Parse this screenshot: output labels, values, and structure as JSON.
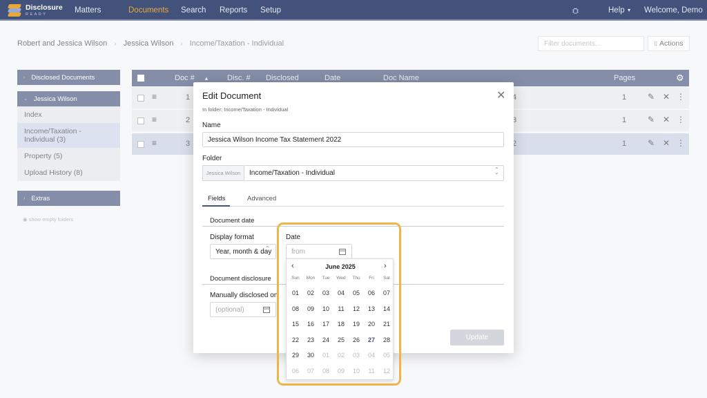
{
  "brand": {
    "name": "Disclosure",
    "tagline": "READY"
  },
  "nav": {
    "items": [
      "Matters",
      "Documents",
      "Search",
      "Reports",
      "Setup"
    ],
    "help": "Help",
    "welcome": "Welcome, Demo"
  },
  "breadcrumb": [
    "Robert and Jessica Wilson",
    "Jessica Wilson",
    "Income/Taxation - Individual"
  ],
  "filter_placeholder": "Filter documents...",
  "actions_label": "Actions",
  "sidebar": {
    "disclosed": "Disclosed Documents",
    "client": "Jessica Wilson",
    "items": [
      "Index",
      "Income/Taxation - Individual (3)",
      "Property (5)",
      "Upload History (8)"
    ],
    "extras": "Extras",
    "show_empty": "show empty folders"
  },
  "table": {
    "headers": {
      "doc": "Doc #",
      "disc": "Disc. #",
      "disclosed": "Disclosed",
      "date": "Date",
      "name": "Doc Name",
      "pages": "Pages"
    },
    "rows": [
      {
        "doc": "1",
        "name_tail": "4",
        "pages": "1"
      },
      {
        "doc": "2",
        "name_tail": "3",
        "pages": "1"
      },
      {
        "doc": "3",
        "name_tail": "2",
        "pages": "1"
      }
    ]
  },
  "modal": {
    "title": "Edit Document",
    "subtitle": "In folder: Income/Taxation - Individual",
    "name_label": "Name",
    "name_value": "Jessica Wilson Income Tax Statement 2022",
    "folder_label": "Folder",
    "folder_prefix": "Jessica Wilson",
    "folder_value": "Income/Taxation - Individual",
    "tabs": [
      "Fields",
      "Advanced"
    ],
    "section_date": "Document date",
    "display_format_label": "Display format",
    "display_format_value": "Year, month & day",
    "date_label": "Date",
    "date_placeholder": "from",
    "section_disclosure": "Document disclosure",
    "manually_disclosed_label": "Manually disclosed on",
    "manually_disclosed_placeholder": "(optional)",
    "update_label": "Update"
  },
  "calendar": {
    "title": "June 2025",
    "weekdays": [
      "Sun",
      "Mon",
      "Tue",
      "Wed",
      "Thu",
      "Fri",
      "Sat"
    ],
    "today": "27",
    "weeks": [
      [
        "01",
        "02",
        "03",
        "04",
        "05",
        "06",
        "07"
      ],
      [
        "08",
        "09",
        "10",
        "11",
        "12",
        "13",
        "14"
      ],
      [
        "15",
        "16",
        "17",
        "18",
        "19",
        "20",
        "21"
      ],
      [
        "22",
        "23",
        "24",
        "25",
        "26",
        "27",
        "28"
      ],
      [
        "29",
        "30",
        "01",
        "02",
        "03",
        "04",
        "05"
      ],
      [
        "06",
        "07",
        "08",
        "09",
        "10",
        "11",
        "12"
      ]
    ]
  },
  "colors": {
    "nav": "#43527a",
    "accent": "#e8a93b",
    "highlight": "#f0b44c"
  }
}
